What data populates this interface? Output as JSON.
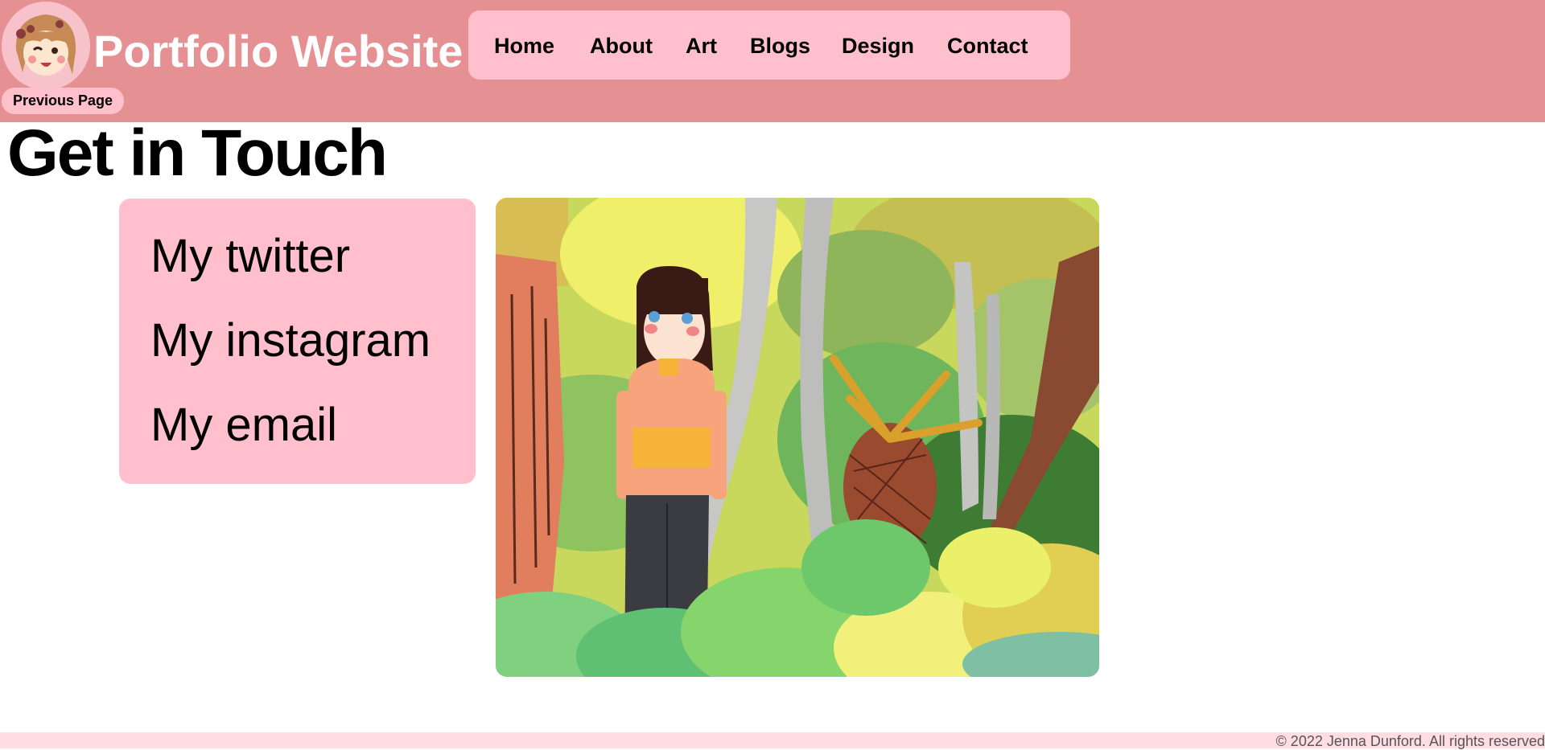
{
  "header": {
    "site_title": "Portfolio Website",
    "background_color": "#e59092",
    "avatar_icon": "girl-avatar-icon"
  },
  "nav": {
    "background_color": "#ffbfcc",
    "items": [
      {
        "label": "Home"
      },
      {
        "label": "About"
      },
      {
        "label": "Art"
      },
      {
        "label": "Blogs"
      },
      {
        "label": "Design"
      },
      {
        "label": "Contact"
      }
    ]
  },
  "previous_page": {
    "label": "Previous Page"
  },
  "main": {
    "title": "Get in Touch",
    "links": [
      {
        "label": "My twitter"
      },
      {
        "label": "My instagram"
      },
      {
        "label": "My email"
      }
    ],
    "illustration": "girl-in-forest-illustration"
  },
  "footer": {
    "text": "© 2022 Jenna Dunford. All rights reserved"
  }
}
